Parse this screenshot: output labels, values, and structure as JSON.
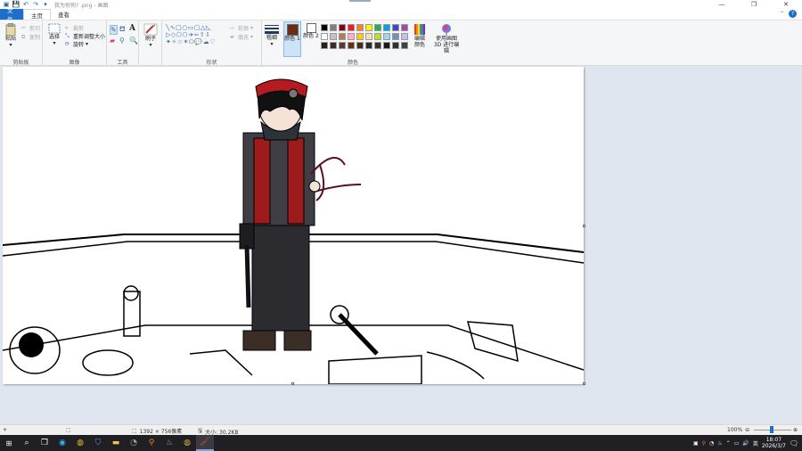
{
  "window": {
    "title": "我为何何? .png - 画图",
    "controls": [
      "—",
      "❐",
      "✕"
    ]
  },
  "tabs": {
    "file": "文件",
    "home": "主页",
    "view": "查看"
  },
  "ribbon": {
    "clipboard": {
      "label": "剪贴板",
      "paste": "粘贴",
      "cut": "剪切",
      "copy": "复制"
    },
    "image": {
      "label": "图像",
      "select": "选择",
      "crop": "裁剪",
      "resize": "重新调整大小",
      "rotate": "旋转"
    },
    "tools": {
      "label": "工具",
      "text_tool": "A"
    },
    "brushes": {
      "label": "刷子"
    },
    "shapes": {
      "label": "形状",
      "outline": "轮廓",
      "fill": "填充"
    },
    "size": {
      "label": "粗细"
    },
    "colors": {
      "label": "颜色",
      "color1": "颜色 1",
      "color2": "颜色 2",
      "edit": "编辑颜色",
      "paint3d": "使用画图 3D 进行编辑",
      "color1_value": "#6b2c12",
      "color2_value": "#ffffff",
      "palette_row1": [
        "#000000",
        "#7f7f7f",
        "#880015",
        "#ed1c24",
        "#ff7f27",
        "#fff200",
        "#22b14c",
        "#00a2e8",
        "#3f48cc",
        "#a349a4"
      ],
      "palette_row2": [
        "#ffffff",
        "#c3c3c3",
        "#b97a57",
        "#ffaec9",
        "#ffc90e",
        "#efe4b0",
        "#b5e61d",
        "#99d9ea",
        "#7092be",
        "#c8bfe7"
      ],
      "palette_row3": [
        "#2a1c18",
        "#3b2a26",
        "#5a3a2e",
        "#6b2c12",
        "#4a2a1a",
        "#2b2b2b",
        "#3a2f28",
        "#1a1a1a",
        "#303030",
        "#404040"
      ]
    }
  },
  "status": {
    "dimensions": "1392 × 756像素",
    "size": "大小: 30.2KB",
    "zoom": "100%"
  },
  "taskbar": {
    "time": "18:07",
    "date": "2026/3/7",
    "ime": "英"
  }
}
